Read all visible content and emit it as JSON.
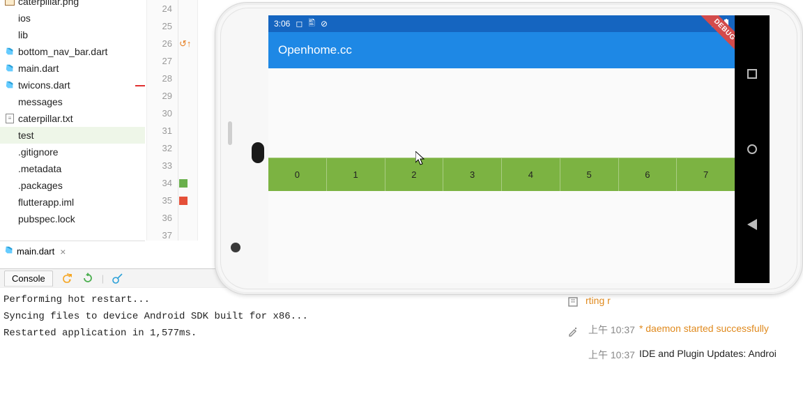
{
  "tree": {
    "items": [
      {
        "label": "caterpillar.png",
        "icon": "image",
        "truncTop": true
      },
      {
        "label": "ios",
        "icon": ""
      },
      {
        "label": "lib",
        "icon": ""
      },
      {
        "label": "bottom_nav_bar.dart",
        "icon": "dart"
      },
      {
        "label": "main.dart",
        "icon": "dart"
      },
      {
        "label": "twicons.dart",
        "icon": "dart"
      },
      {
        "label": "messages",
        "icon": ""
      },
      {
        "label": "caterpillar.txt",
        "icon": "txt"
      },
      {
        "label": "test",
        "icon": "",
        "sel": true
      },
      {
        "label": ".gitignore",
        "icon": ""
      },
      {
        "label": ".metadata",
        "icon": ""
      },
      {
        "label": ".packages",
        "icon": ""
      },
      {
        "label": "flutterapp.iml",
        "icon": ""
      },
      {
        "label": "pubspec.lock",
        "icon": ""
      }
    ]
  },
  "openTab": {
    "label": "main.dart"
  },
  "gutter": {
    "lines": [
      24,
      25,
      26,
      27,
      28,
      29,
      30,
      31,
      32,
      33,
      34,
      35,
      36,
      37
    ],
    "marks": {
      "34": "green",
      "35": "red"
    },
    "arrowLine": 26
  },
  "console": {
    "tab": "Console",
    "lines": [
      "Performing hot restart...",
      "Syncing files to device Android SDK built for x86...",
      "Restarted application in 1,577ms."
    ]
  },
  "events": {
    "truncated_first": "rting r",
    "rows": [
      {
        "ts": "上午 10:37",
        "msg": "* daemon started successfully",
        "kind": "orange"
      },
      {
        "ts": "上午 10:37",
        "msg": "IDE and Plugin Updates: Androi",
        "kind": "plain"
      }
    ]
  },
  "emulator": {
    "time": "3:06",
    "appTitle": "Openhome.cc",
    "debugLabel": "DEBUG",
    "stripValues": [
      "0",
      "1",
      "2",
      "3",
      "4",
      "5",
      "6",
      "7"
    ]
  }
}
